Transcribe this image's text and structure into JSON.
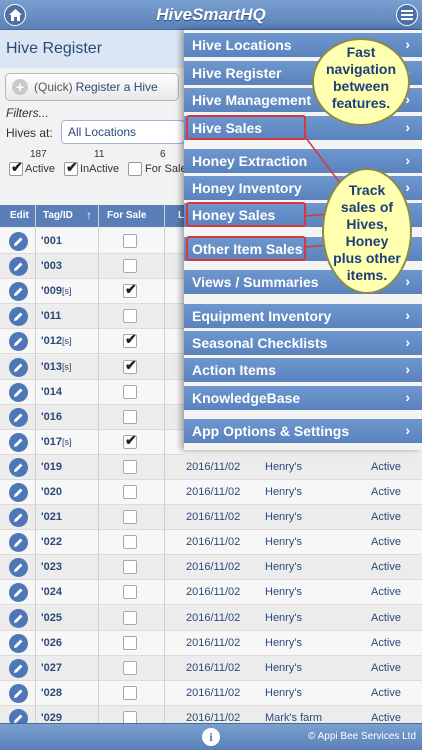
{
  "app": {
    "title": "HiveSmartHQ"
  },
  "page": {
    "title": "Hive Register"
  },
  "register_button": {
    "quick": "(Quick)",
    "label": "Register a Hive"
  },
  "filters": {
    "label": "Filters...",
    "hives_at_label": "Hives at:",
    "location_value": "All Locations"
  },
  "status_counts": [
    {
      "count": "187",
      "label": "Active",
      "checked": true
    },
    {
      "count": "11",
      "label": "InActive",
      "checked": true
    },
    {
      "count": "6",
      "label": "For Sale",
      "checked": false
    }
  ],
  "table": {
    "headers": {
      "edit": "Edit",
      "tag": "Tag/ID",
      "sort_arrow": "↑",
      "for_sale": "For Sale",
      "loc": "L"
    },
    "rows": [
      {
        "tag": "'001",
        "suffix": "",
        "for_sale": false
      },
      {
        "tag": "'003",
        "suffix": "",
        "for_sale": false
      },
      {
        "tag": "'009",
        "suffix": "[s]",
        "for_sale": true
      },
      {
        "tag": "'011",
        "suffix": "",
        "for_sale": false
      },
      {
        "tag": "'012",
        "suffix": "[s]",
        "for_sale": true
      },
      {
        "tag": "'013",
        "suffix": "[s]",
        "for_sale": true
      },
      {
        "tag": "'014",
        "suffix": "",
        "for_sale": false
      },
      {
        "tag": "'016",
        "suffix": "",
        "for_sale": false
      },
      {
        "tag": "'017",
        "suffix": "[s]",
        "for_sale": true
      },
      {
        "tag": "'019",
        "suffix": "",
        "for_sale": false,
        "date": "2016/11/02",
        "location": "Henry's",
        "status": "Active"
      },
      {
        "tag": "'020",
        "suffix": "",
        "for_sale": false,
        "date": "2016/11/02",
        "location": "Henry's",
        "status": "Active"
      },
      {
        "tag": "'021",
        "suffix": "",
        "for_sale": false,
        "date": "2016/11/02",
        "location": "Henry's",
        "status": "Active"
      },
      {
        "tag": "'022",
        "suffix": "",
        "for_sale": false,
        "date": "2016/11/02",
        "location": "Henry's",
        "status": "Active"
      },
      {
        "tag": "'023",
        "suffix": "",
        "for_sale": false,
        "date": "2016/11/02",
        "location": "Henry's",
        "status": "Active"
      },
      {
        "tag": "'024",
        "suffix": "",
        "for_sale": false,
        "date": "2016/11/02",
        "location": "Henry's",
        "status": "Active"
      },
      {
        "tag": "'025",
        "suffix": "",
        "for_sale": false,
        "date": "2016/11/02",
        "location": "Henry's",
        "status": "Active"
      },
      {
        "tag": "'026",
        "suffix": "",
        "for_sale": false,
        "date": "2016/11/02",
        "location": "Henry's",
        "status": "Active"
      },
      {
        "tag": "'027",
        "suffix": "",
        "for_sale": false,
        "date": "2016/11/02",
        "location": "Henry's",
        "status": "Active"
      },
      {
        "tag": "'028",
        "suffix": "",
        "for_sale": false,
        "date": "2016/11/02",
        "location": "Henry's",
        "status": "Active"
      },
      {
        "tag": "'029",
        "suffix": "",
        "for_sale": false,
        "date": "2016/11/02",
        "location": "Mark's farm",
        "status": "Active"
      }
    ]
  },
  "menu": {
    "items": [
      {
        "label": "Hive Locations",
        "highlighted": false
      },
      {
        "label": "Hive Register",
        "highlighted": false
      },
      {
        "label": "Hive Management",
        "highlighted": false
      },
      {
        "label": "Hive Sales",
        "highlighted": true
      },
      {
        "label": "Honey Extraction",
        "highlighted": false
      },
      {
        "label": "Honey Inventory",
        "highlighted": false
      },
      {
        "label": "Honey Sales",
        "highlighted": true
      },
      {
        "label": "Other Item Sales",
        "highlighted": true
      },
      {
        "label": "Views / Summaries",
        "highlighted": false
      },
      {
        "label": "Equipment Inventory",
        "highlighted": false
      },
      {
        "label": "Seasonal Checklists",
        "highlighted": false
      },
      {
        "label": "Action Items",
        "highlighted": false
      },
      {
        "label": "KnowledgeBase",
        "highlighted": false
      },
      {
        "label": "App Options & Settings",
        "highlighted": false
      }
    ],
    "chevron": "›"
  },
  "callouts": [
    {
      "lines": [
        "Fast",
        "navigation",
        "between",
        "features."
      ]
    },
    {
      "lines": [
        "Track",
        "sales of",
        "Hives,",
        "Honey",
        "plus other",
        "items."
      ]
    }
  ],
  "footer": {
    "info": "i",
    "copyright": "© Appi Bee Services Ltd"
  },
  "icons": {
    "home": "home-icon",
    "menu": "menu-icon",
    "edit": "pencil-icon",
    "info": "info-icon",
    "add": "plus-icon"
  },
  "colors": {
    "header": "#5a80b8",
    "menu_item": "#5a82bd",
    "highlight_border": "#d4393f",
    "callout_bg": "#ffffb0"
  }
}
